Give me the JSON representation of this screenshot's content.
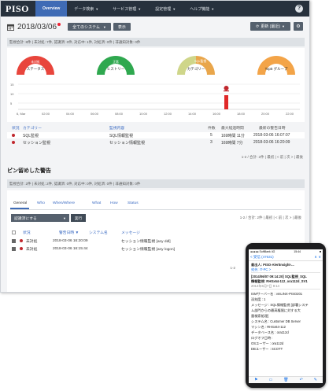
{
  "nav": {
    "logo": "PISO",
    "items": [
      {
        "label": "Overview",
        "active": true
      },
      {
        "label": "データ検索",
        "caret": true
      },
      {
        "label": "サービス管理",
        "caret": true
      },
      {
        "label": "設定管理",
        "caret": true
      },
      {
        "label": "ヘルプ機能",
        "caret": true
      }
    ],
    "help": "?"
  },
  "toolbar": {
    "date": "2018/03/06",
    "system_select": "全てのシステム",
    "show_button": "表示",
    "refresh_button": "更新 (最近)"
  },
  "summary1": "監視合計: 8件 | 未対処: 7件, 認識済: 0件, 対応中: 1件, 対処済: 0件 | 非通知対象: 0件",
  "gauges": [
    {
      "label": "ステータス",
      "inner_label": "未対処",
      "color": "#e8453c"
    },
    {
      "label": "ヒストリー",
      "inner_label": "正常",
      "color": "#2fa84f"
    },
    {
      "label": "カテゴリー",
      "inner_label": "SQL監視",
      "color": "#b9c86a"
    },
    {
      "label": "Top5 グループ",
      "inner_label": "",
      "color": "#f3a448"
    }
  ],
  "timeline": {
    "y_ticks": [
      "15",
      "10",
      "5"
    ],
    "x_ticks": [
      "6, Mar",
      "02:00",
      "04:00",
      "06:00",
      "08:00",
      "10:00",
      "12:00",
      "14:00",
      "16:00",
      "18:00",
      "20:00",
      "22:00"
    ]
  },
  "summary_table": {
    "headers": [
      "カテゴリー",
      "監視内容",
      "件数",
      "最大経過時間",
      "最新の警告日時"
    ],
    "rows": [
      {
        "category": "SQL監視",
        "content": "SQL情報監視",
        "count": "5",
        "max_elapsed": "169時間 11分",
        "latest": "2018-03-06 16:07:07"
      },
      {
        "category": "セッション監視",
        "content": "セッション情報監視",
        "count": "3",
        "max_elapsed": "169時間 7分",
        "latest": "2018-03-06 16:20:09"
      }
    ],
    "pager": "1-2 / 合計: 2件 | 最初 | < 前 | 次 > | 最後"
  },
  "section_title": "ピン留めした警告",
  "summary2": "監視合計: 2件 | 未対処: 2件, 認識済: 0件, 対応中: 0件, 対処済: 0件 | 非通知対象: 0件",
  "tabs": [
    "General",
    "Who",
    "When/Where",
    "What",
    "How",
    "Status"
  ],
  "status_select": "認識済にする",
  "exec_button": "実行",
  "pager2": "1-2 / 合計: 2件 | 最初 | < 前 | 次 > | 最後",
  "alerts_table": {
    "headers": [
      "状況",
      "警告日時",
      "システム名",
      "メッセージ"
    ],
    "rows": [
      {
        "status": "未対処",
        "datetime": "2018-03-06 16:20:09",
        "message": "セッション情報監視 [any ddl]"
      },
      {
        "status": "未対処",
        "datetime": "2018-03-06 16:15:44",
        "message": "セッション情報監視 [any logon]"
      }
    ],
    "pager": "1-2"
  },
  "phone": {
    "status_left": "●●●●● SoftBank 4G",
    "status_time": "15:44",
    "status_right": "■",
    "back_label": "< 受信 (47631)",
    "lines": [
      {
        "text": "差出人: PISO-AlertInsight-...",
        "style": "bold"
      },
      {
        "text": "宛先: IT-PC >",
        "style": "blue"
      },
      {
        "text": "[2014/06/07 09:14:20] SQL監視_SQL",
        "style": "bold"
      },
      {
        "text": "情報監視: RHSx64-112_ora112d_SV1",
        "style": "bold"
      },
      {
        "text": "2014年6月7日 9:14",
        "style": ""
      },
      {
        "text": "ISMサーバー名   : vmLINX-PISO201",
        "style": ""
      },
      {
        "text": "深刻度          : 1",
        "style": ""
      },
      {
        "text": "メッセージ      : SQL情報監視 [部署システ",
        "style": ""
      },
      {
        "text": "ム部門からの最高権限に対する大",
        "style": ""
      },
      {
        "text": "量検索処理]",
        "style": ""
      },
      {
        "text": "システム名      : Customer DB Server",
        "style": ""
      },
      {
        "text": "マシン名        : RHSx64-112",
        "style": ""
      },
      {
        "text": "データベース名  : ora112d",
        "style": ""
      },
      {
        "text": "ログオフ日時    : ",
        "style": ""
      },
      {
        "text": "OSユーザー      : ora112d",
        "style": ""
      },
      {
        "text": "DBユーザー      : SCOTT",
        "style": ""
      }
    ]
  }
}
